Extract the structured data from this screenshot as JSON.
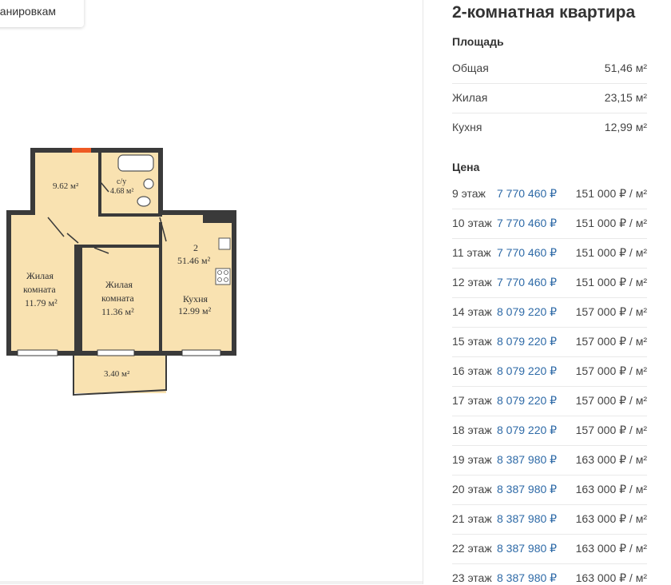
{
  "nav": {
    "back_label": "К планировкам"
  },
  "plan": {
    "rooms": [
      {
        "name": "",
        "area": "9.62 м²"
      },
      {
        "name": "с/у",
        "area": "4.68 м²"
      },
      {
        "name_line1": "Жилая",
        "name_line2": "комната",
        "area": "11.79 м²"
      },
      {
        "name_line1": "Жилая",
        "name_line2": "комната",
        "area": "11.36 м²"
      },
      {
        "name": "Кухня",
        "area": "12.99 м²"
      },
      {
        "name": "",
        "area": "3.40 м²"
      }
    ],
    "total_label": "2",
    "total_area": "51.46 м²"
  },
  "apartment": {
    "title": "2-комнатная квартира",
    "area_title": "Площадь",
    "areas": [
      {
        "label": "Общая",
        "value": "51,46 м²"
      },
      {
        "label": "Жилая",
        "value": "23,15 м²"
      },
      {
        "label": "Кухня",
        "value": "12,99 м²"
      }
    ],
    "price_title": "Цена",
    "prices": [
      {
        "floor": "9 этаж",
        "price": "7 770 460 ₽",
        "per_m2": "151 000 ₽ / м²"
      },
      {
        "floor": "10 этаж",
        "price": "7 770 460 ₽",
        "per_m2": "151 000 ₽ / м²"
      },
      {
        "floor": "11 этаж",
        "price": "7 770 460 ₽",
        "per_m2": "151 000 ₽ / м²"
      },
      {
        "floor": "12 этаж",
        "price": "7 770 460 ₽",
        "per_m2": "151 000 ₽ / м²"
      },
      {
        "floor": "14 этаж",
        "price": "8 079 220 ₽",
        "per_m2": "157 000 ₽ / м²"
      },
      {
        "floor": "15 этаж",
        "price": "8 079 220 ₽",
        "per_m2": "157 000 ₽ / м²"
      },
      {
        "floor": "16 этаж",
        "price": "8 079 220 ₽",
        "per_m2": "157 000 ₽ / м²"
      },
      {
        "floor": "17 этаж",
        "price": "8 079 220 ₽",
        "per_m2": "157 000 ₽ / м²"
      },
      {
        "floor": "18 этаж",
        "price": "8 079 220 ₽",
        "per_m2": "157 000 ₽ / м²"
      },
      {
        "floor": "19 этаж",
        "price": "8 387 980 ₽",
        "per_m2": "163 000 ₽ / м²"
      },
      {
        "floor": "20 этаж",
        "price": "8 387 980 ₽",
        "per_m2": "163 000 ₽ / м²"
      },
      {
        "floor": "21 этаж",
        "price": "8 387 980 ₽",
        "per_m2": "163 000 ₽ / м²"
      },
      {
        "floor": "22 этаж",
        "price": "8 387 980 ₽",
        "per_m2": "163 000 ₽ / м²"
      },
      {
        "floor": "23 этаж",
        "price": "8 387 980 ₽",
        "per_m2": "163 000 ₽ / м²"
      }
    ]
  },
  "colors": {
    "floor_fill": "#f9e2b1",
    "wall": "#3a3a3a",
    "accent": "#ee5a24",
    "link": "#2e6aa7"
  }
}
